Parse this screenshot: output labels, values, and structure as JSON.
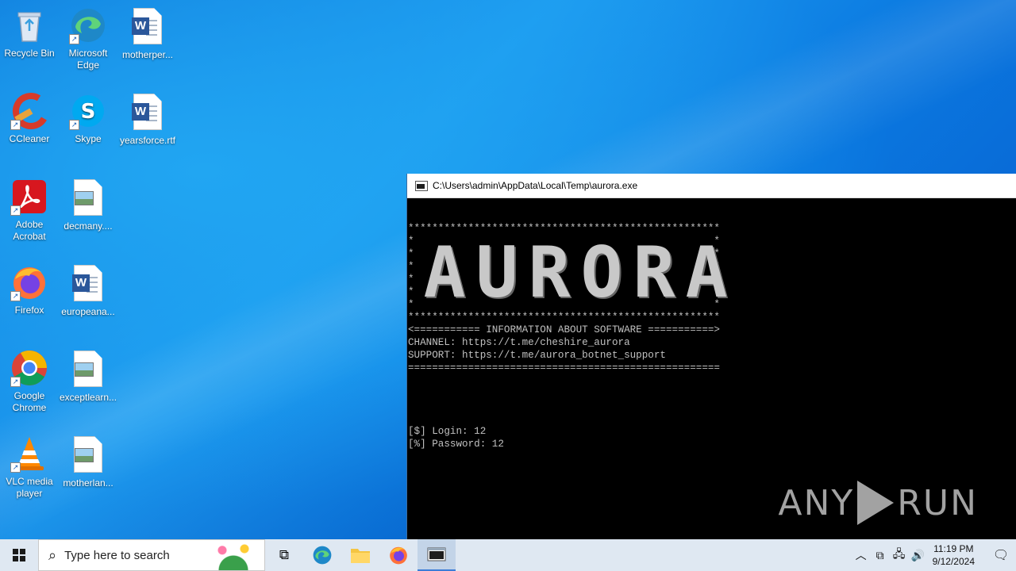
{
  "desktop": {
    "icons": [
      {
        "label": "Recycle Bin",
        "icon": "recycle-bin-icon"
      },
      {
        "label": "Microsoft Edge",
        "icon": "edge-icon"
      },
      {
        "label": "motherper...",
        "icon": "word-doc-icon"
      },
      {
        "label": "CCleaner",
        "icon": "ccleaner-icon"
      },
      {
        "label": "Skype",
        "icon": "skype-icon"
      },
      {
        "label": "yearsforce.rtf",
        "icon": "word-doc-icon"
      },
      {
        "label": "Adobe Acrobat",
        "icon": "acrobat-icon"
      },
      {
        "label": "decmany....",
        "icon": "image-file-icon"
      },
      {
        "label": "Firefox",
        "icon": "firefox-icon"
      },
      {
        "label": "europeana...",
        "icon": "word-doc-icon"
      },
      {
        "label": "Google Chrome",
        "icon": "chrome-icon"
      },
      {
        "label": "exceptlearn...",
        "icon": "image-file-icon"
      },
      {
        "label": "VLC media player",
        "icon": "vlc-icon"
      },
      {
        "label": "motherlan...",
        "icon": "image-file-icon"
      }
    ]
  },
  "console": {
    "title": "C:\\Users\\admin\\AppData\\Local\\Temp\\aurora.exe",
    "banner_letters": [
      "A",
      "U",
      "R",
      "O",
      "R",
      "A"
    ],
    "lines": [
      "****************************************************",
      "*                                                  *",
      "*                                                  *",
      "*                                                  *",
      "*                                                  *",
      "*                                                  *",
      "*                                                  *",
      "****************************************************",
      "<=========== INFORMATION ABOUT SOFTWARE ===========>",
      "CHANNEL: https://t.me/cheshire_aurora",
      "SUPPORT: https://t.me/aurora_botnet_support",
      "====================================================",
      "",
      "",
      "",
      "",
      "[$] Login: 12",
      "[%] Password: 12"
    ]
  },
  "watermark": {
    "left": "ANY",
    "right": "RUN"
  },
  "taskbar": {
    "search_placeholder": "Type here to search",
    "time": "11:19 PM",
    "date": "9/12/2024"
  }
}
